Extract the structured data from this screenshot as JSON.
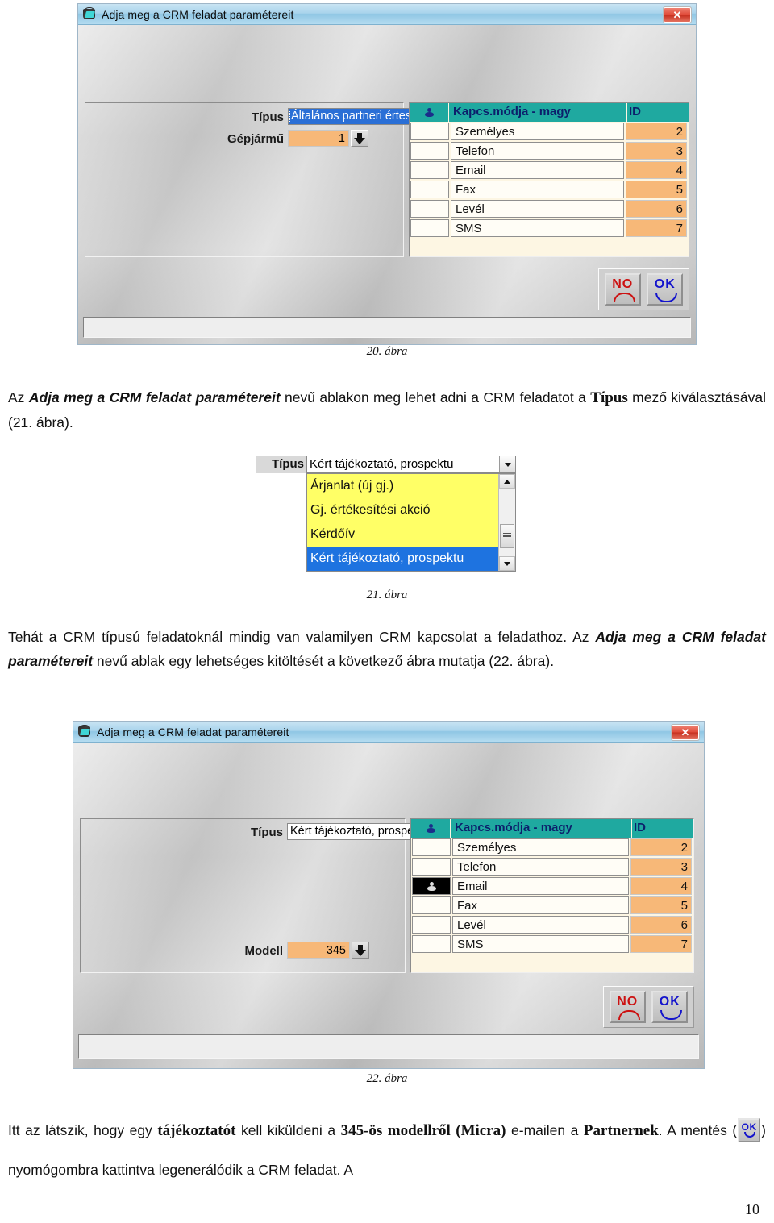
{
  "document": {
    "page_number": "10",
    "figure20_caption": "20. ábra",
    "figure21_caption": "21. ábra",
    "figure22_caption": "22. ábra",
    "paragraph1": {
      "part1": "Az ",
      "bold1": "Adja meg a CRM feladat paramétereit",
      "part2": " nevű ablakon meg lehet adni a CRM feladatot a ",
      "bold2": "Típus",
      "part3": " mező kiválasztásával (21. ábra)."
    },
    "paragraph2": {
      "part1": "Tehát a CRM típusú feladatoknál mindig van valamilyen CRM kapcsolat a feladathoz. Az ",
      "bold1": "Adja meg a CRM feladat paramétereit",
      "part2": " nevű ablak egy lehetséges kitöltését a következő ábra mutatja (22. ábra)."
    },
    "paragraph3": {
      "part1": "Itt az látszik, hogy egy ",
      "bold1": "tájékoztatót",
      "part2": " kell kiküldeni a ",
      "bold2": "345-ös modellről (Micra)",
      "part3": " e-mailen a ",
      "bold3": "Partnernek",
      "part4": ". A mentés (",
      "part5": ") nyomógombra kattintva legenerálódik a CRM feladat. A"
    }
  },
  "dialog1": {
    "title": "Adja meg a CRM feladat paramétereit",
    "close_label": "✕",
    "fields": {
      "tipus_label": "Típus",
      "tipus_value": "Általános partneri értesítés",
      "gepjarmu_label": "Gépjármű",
      "gepjarmu_value": "1"
    },
    "grid": {
      "headers": {
        "marker": "",
        "name": "Kapcs.módja - magy",
        "id": "ID"
      },
      "rows": [
        {
          "name": "Személyes",
          "id": "2",
          "selected": false
        },
        {
          "name": "Telefon",
          "id": "3",
          "selected": false
        },
        {
          "name": "Email",
          "id": "4",
          "selected": false
        },
        {
          "name": "Fax",
          "id": "5",
          "selected": false
        },
        {
          "name": "Levél",
          "id": "6",
          "selected": false
        },
        {
          "name": "SMS",
          "id": "7",
          "selected": false
        }
      ]
    },
    "buttons": {
      "no_label": "NO",
      "ok_label": "OK"
    },
    "statusbar_text": ""
  },
  "dropdown_figure": {
    "tipus_label": "Típus",
    "selected_value": "Kért tájékoztató, prospektu",
    "options": [
      {
        "label": "Árjanlat (új gj.)",
        "selected": false
      },
      {
        "label": "Gj. értékesítési akció",
        "selected": false
      },
      {
        "label": "Kérdőív",
        "selected": false
      },
      {
        "label": "Kért tájékoztató, prospektu",
        "selected": true
      }
    ]
  },
  "dialog2": {
    "title": "Adja meg a CRM feladat paramétereit",
    "close_label": "✕",
    "fields": {
      "tipus_label": "Típus",
      "tipus_value": "Kért tájékoztató, prospektus",
      "modell_label": "Modell",
      "modell_value": "345"
    },
    "grid": {
      "headers": {
        "marker": "",
        "name": "Kapcs.módja - magy",
        "id": "ID"
      },
      "rows": [
        {
          "name": "Személyes",
          "id": "2",
          "selected": false
        },
        {
          "name": "Telefon",
          "id": "3",
          "selected": false
        },
        {
          "name": "Email",
          "id": "4",
          "selected": true
        },
        {
          "name": "Fax",
          "id": "5",
          "selected": false
        },
        {
          "name": "Levél",
          "id": "6",
          "selected": false
        },
        {
          "name": "SMS",
          "id": "7",
          "selected": false
        }
      ]
    },
    "buttons": {
      "no_label": "NO",
      "ok_label": "OK"
    },
    "statusbar_text": ""
  },
  "colors": {
    "grid_header": "#1fa9a0",
    "grid_value": "#f7b878",
    "selection_blue": "#2a6fd6",
    "dropdown_yellow": "#ffff66",
    "close_red": "#d8412c",
    "no_red": "#cc1111",
    "ok_blue": "#1414cc"
  }
}
